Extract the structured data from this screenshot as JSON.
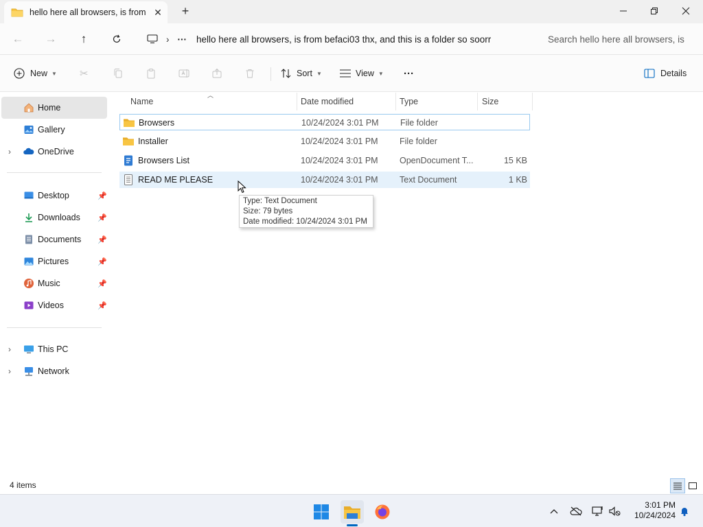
{
  "window": {
    "tab_title": "hello here all browsers, is from",
    "new_tab": "+"
  },
  "address": {
    "path": "hello here all browsers, is from befaci03 thx, and this is a folder so soorr",
    "overflow": "···",
    "search_placeholder": "Search hello here all browsers, is"
  },
  "toolbar": {
    "new_label": "New",
    "sort_label": "Sort",
    "view_label": "View",
    "more_label": "···",
    "details_label": "Details"
  },
  "sidebar": {
    "items": [
      {
        "label": "Home",
        "icon": "home-icon",
        "selected": true
      },
      {
        "label": "Gallery",
        "icon": "gallery-icon"
      },
      {
        "label": "OneDrive",
        "icon": "onedrive-icon",
        "expandable": true
      },
      {
        "label": "Desktop",
        "icon": "desktop-icon",
        "pinned": true
      },
      {
        "label": "Downloads",
        "icon": "downloads-icon",
        "pinned": true
      },
      {
        "label": "Documents",
        "icon": "documents-icon",
        "pinned": true
      },
      {
        "label": "Pictures",
        "icon": "pictures-icon",
        "pinned": true
      },
      {
        "label": "Music",
        "icon": "music-icon",
        "pinned": true
      },
      {
        "label": "Videos",
        "icon": "videos-icon",
        "pinned": true
      },
      {
        "label": "This PC",
        "icon": "this-pc-icon",
        "expandable": true
      },
      {
        "label": "Network",
        "icon": "network-icon",
        "expandable": true
      }
    ]
  },
  "columns": [
    "Name",
    "Date modified",
    "Type",
    "Size"
  ],
  "files": [
    {
      "name": "Browsers",
      "date": "10/24/2024 3:01 PM",
      "type": "File folder",
      "size": "",
      "icon": "folder-icon"
    },
    {
      "name": "Installer",
      "date": "10/24/2024 3:01 PM",
      "type": "File folder",
      "size": "",
      "icon": "folder-icon"
    },
    {
      "name": "Browsers List",
      "date": "10/24/2024 3:01 PM",
      "type": "OpenDocument T...",
      "size": "15 KB",
      "icon": "odt-document-icon"
    },
    {
      "name": "READ ME PLEASE",
      "date": "10/24/2024 3:01 PM",
      "type": "Text Document",
      "size": "1 KB",
      "icon": "text-document-icon"
    }
  ],
  "tooltip": {
    "type": "Type: Text Document",
    "size": "Size: 79 bytes",
    "date": "Date modified: 10/24/2024 3:01 PM"
  },
  "status": {
    "item_count": "4 items"
  },
  "taskbar": {
    "time": "3:01 PM",
    "date": "10/24/2024"
  },
  "colors": {
    "accent": "#0067c0",
    "folder": "#f8c543",
    "hover_row": "#e5f1fb"
  }
}
